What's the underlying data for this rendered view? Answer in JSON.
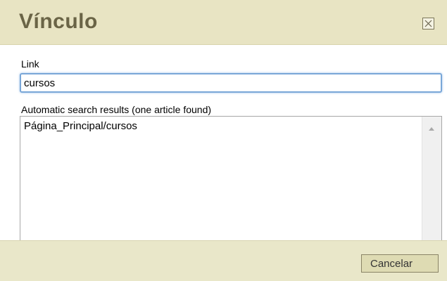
{
  "dialog": {
    "title": "Vínculo",
    "close_icon": "close-icon"
  },
  "form": {
    "link_label": "Link",
    "link_value": "cursos",
    "results_label": "Automatic search results (one article found)",
    "results": [
      "Página_Principal/cursos"
    ]
  },
  "footer": {
    "cancel_label": "Cancelar"
  },
  "colors": {
    "title": "#6a6446",
    "panel": "#e9e7c9",
    "input_focus": "#7aa7d8"
  }
}
